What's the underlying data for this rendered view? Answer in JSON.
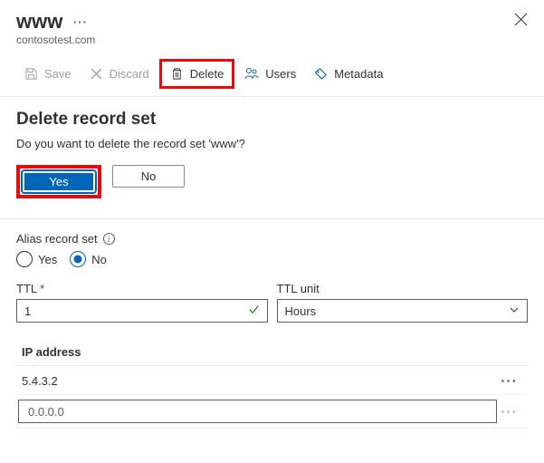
{
  "header": {
    "title": "www",
    "subtitle": "contosotest.com"
  },
  "toolbar": {
    "save": "Save",
    "discard": "Discard",
    "delete": "Delete",
    "users": "Users",
    "metadata": "Metadata"
  },
  "dialog": {
    "title": "Delete record set",
    "text": "Do you want to delete the record set 'www'?",
    "yes": "Yes",
    "no": "No"
  },
  "alias": {
    "label": "Alias record set",
    "yes": "Yes",
    "no": "No"
  },
  "ttl": {
    "label": "TTL",
    "value": "1",
    "unit_label": "TTL unit",
    "unit_value": "Hours"
  },
  "ip": {
    "header": "IP address",
    "rows": [
      "5.4.3.2"
    ],
    "placeholder": "0.0.0.0"
  }
}
